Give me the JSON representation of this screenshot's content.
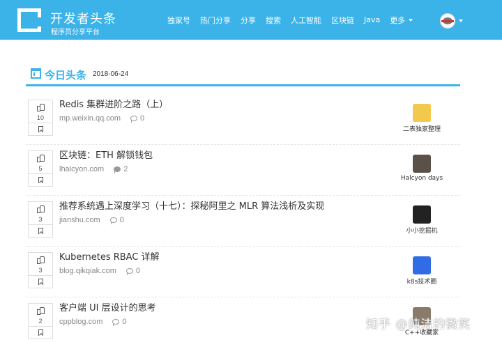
{
  "brand": {
    "title": "开发者头条",
    "subtitle": "程序员分享平台"
  },
  "nav": {
    "items": [
      "独家号",
      "热门分享",
      "分享",
      "搜索",
      "人工智能",
      "区块链",
      "Java"
    ],
    "more_label": "更多"
  },
  "section": {
    "title": "今日头条",
    "date": "2018-06-24"
  },
  "articles": [
    {
      "title": "Redis 集群进阶之路（上）",
      "domain": "mp.weixin.qq.com",
      "comments": "0",
      "votes": "10",
      "source": "二表独家整理",
      "source_color": "#f2c94c"
    },
    {
      "title": "区块链：ETH 解锁钱包",
      "domain": "lhalcyon.com",
      "comments": "2",
      "votes": "5",
      "source": "Halcyon days",
      "source_color": "#5a5248"
    },
    {
      "title": "推荐系统遇上深度学习（十七）：探秘阿里之 MLR 算法浅析及实现",
      "domain": "jianshu.com",
      "comments": "0",
      "votes": "3",
      "source": "小小挖掘机",
      "source_color": "#222222"
    },
    {
      "title": "Kubernetes RBAC 详解",
      "domain": "blog.qikqiak.com",
      "comments": "0",
      "votes": "3",
      "source": "k8s技术圈",
      "source_color": "#326ce5"
    },
    {
      "title": "客户端 UI 层设计的思考",
      "domain": "cppblog.com",
      "comments": "0",
      "votes": "2",
      "source": "C++收藏家",
      "source_color": "#8a7a6a"
    }
  ],
  "watermark": "知乎 @纯洁的微笑",
  "colors": {
    "accent": "#3bb3e9"
  }
}
